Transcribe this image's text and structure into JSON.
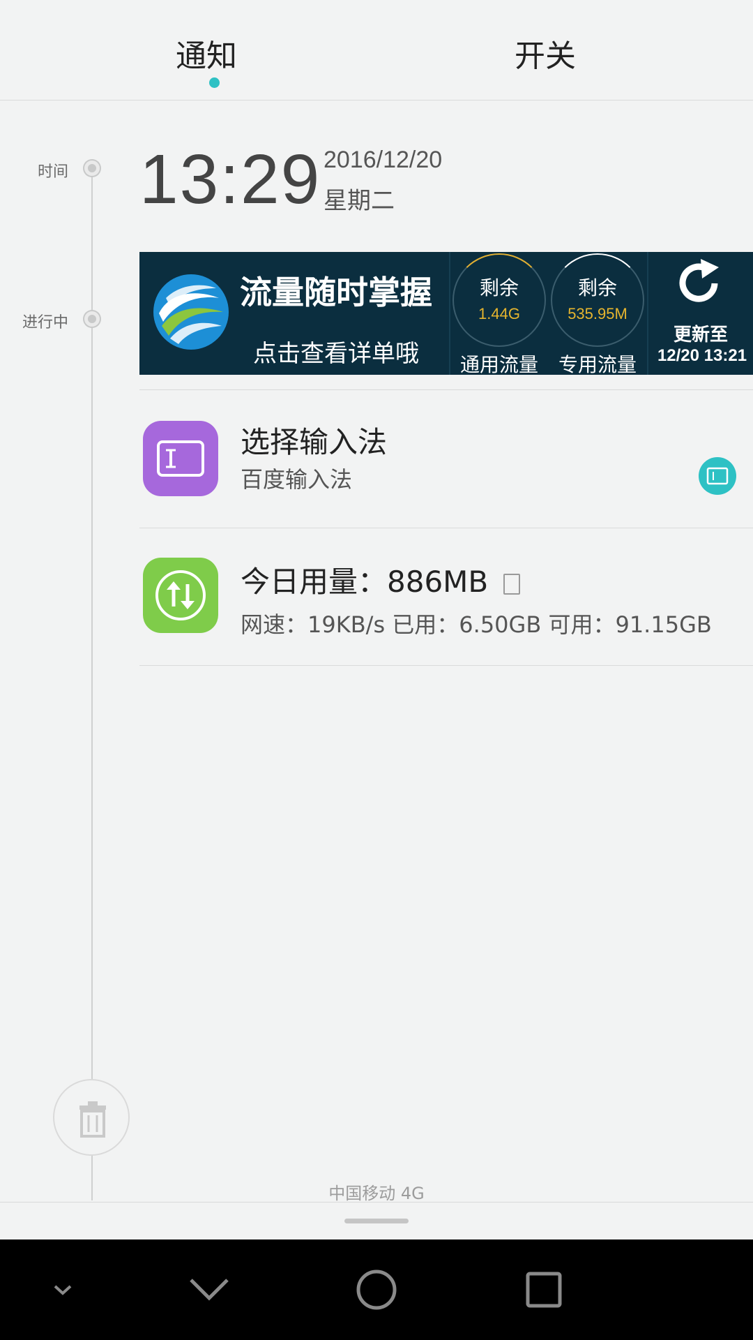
{
  "tabs": {
    "notify_label": "通知",
    "switch_label": "开关"
  },
  "timeline": {
    "time_label": "时间",
    "ongoing_label": "进行中"
  },
  "clock": {
    "time": "13:29",
    "date": "2016/12/20",
    "weekday": "星期二"
  },
  "banner": {
    "headline": "流量随时掌握",
    "subline": "点击查看详单哦",
    "general": {
      "title": "剩余",
      "value": "1.44G",
      "caption": "通用流量"
    },
    "special": {
      "title": "剩余",
      "value": "535.95M",
      "caption": "专用流量"
    },
    "refresh": {
      "title": "更新至",
      "time": "12/20 13:21"
    },
    "colors": {
      "background": "#0b2e3f",
      "value": "#e6b52e"
    }
  },
  "notifications": [
    {
      "title": "选择输入法",
      "text": "百度输入法",
      "icon": "keyboard-input-icon",
      "color": "#a668dc"
    },
    {
      "title": "今日用量：886MB",
      "text": "网速：19KB/s 已用：6.50GB 可用：91.15GB",
      "icon": "data-transfer-icon",
      "color": "#7fcc4a"
    }
  ],
  "footer": {
    "carrier": "中国移动 4G"
  },
  "accent_color": "#2ec1c4"
}
